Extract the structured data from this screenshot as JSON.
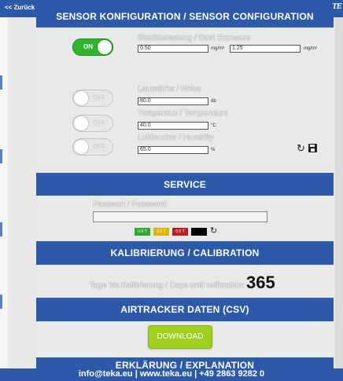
{
  "header": {
    "back_label": "<< Zurück",
    "logo_text": "TE"
  },
  "sensor_config": {
    "title": "SENSOR KONFIGURATION / SENSOR CONFIGURATION",
    "sensors": [
      {
        "toggle": "ON",
        "label": "Staubbelastung / Dust Exposure",
        "value1": "0.50",
        "unit1": "mg/m³",
        "value2": "1.25",
        "unit2": "mg/m³"
      },
      {
        "toggle": "OFF",
        "label": "Lautstärke / Noise",
        "value1": "80.0",
        "unit1": "db"
      },
      {
        "toggle": "OFF",
        "label": "Temperatur / Temperature",
        "value1": "40.0",
        "unit1": "°C"
      },
      {
        "toggle": "OFF",
        "label": "Luftfeuchte / Humidity",
        "value1": "65.0",
        "unit1": "%"
      }
    ]
  },
  "service": {
    "title": "SERVICE",
    "password_label": "Passwort / Password",
    "password_value": "",
    "swatches": [
      {
        "label": "0.0 T",
        "color": "#2fa82f"
      },
      {
        "label": "0.0 T",
        "color": "#d9b400"
      },
      {
        "label": "0.0 T",
        "color": "#b52020"
      },
      {
        "label": "",
        "color": "#000000"
      }
    ]
  },
  "calibration": {
    "title": "KALIBRIERUNG / CALIBRATION",
    "days_label": "Tage bis Kalibrierung / Days until calibration:",
    "days_value": "365"
  },
  "airtracker": {
    "title": "AIRTRACKER DATEN (CSV)",
    "download_label": "DOWNLOAD"
  },
  "explanation": {
    "title": "ERKLÄRUNG / EXPLANATION"
  },
  "footer": {
    "text": "info@teka.eu | www.teka.eu | +49 2863 9282 0"
  },
  "colors": {
    "accent": "#2d5aa8",
    "toggle_on": "#2fb52f",
    "download": "#9fd020"
  }
}
